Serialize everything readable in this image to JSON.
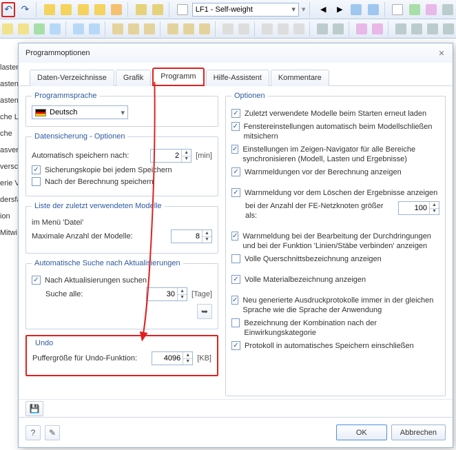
{
  "toolbar": {
    "undo": "↶",
    "redo": "↷",
    "lf_combo": "LF1 - Self-weight"
  },
  "sidebar_scraps": [
    "laster",
    " ",
    "asten",
    "asten",
    " ",
    "che Li",
    "che ",
    "",
    "asverfo",
    "versch",
    "",
    "erie Vo",
    "dersfa",
    "",
    "ion",
    " ",
    "Mitwi"
  ],
  "dialog": {
    "title": "Programmoptionen",
    "tabs": {
      "daten": "Daten-Verzeichnisse",
      "grafik": "Grafik",
      "programm": "Programm",
      "hilfe": "Hilfe-Assistent",
      "kommentare": "Kommentare"
    },
    "left": {
      "lang": {
        "legend": "Programmsprache",
        "value": "Deutsch"
      },
      "backup": {
        "legend": "Datensicherung - Optionen",
        "auto_label": "Automatisch speichern nach:",
        "auto_value": "2",
        "auto_unit": "[min]",
        "copy_label": "Sicherungskopie bei jedem Speichern",
        "after_label": "Nach der Berechnung speichern"
      },
      "recent": {
        "legend": "Liste der zuletzt verwendeten Modelle",
        "sub": "im Menü 'Datei'",
        "max_label": "Maximale Anzahl der Modelle:",
        "max_value": "8"
      },
      "updates": {
        "legend": "Automatische Suche nach Aktualisierungen",
        "search_label": "Nach Aktualisierungen suchen",
        "every_label": "Suche alle:",
        "every_value": "30",
        "every_unit": "[Tage]"
      },
      "undo": {
        "legend": "Undo",
        "buffer_label": "Puffergröße für Undo-Funktion:",
        "buffer_value": "4096",
        "buffer_unit": "[KB]"
      }
    },
    "right": {
      "legend": "Optionen",
      "opt1": "Zuletzt verwendete Modelle beim Starten erneut laden",
      "opt2": "Fenstereinstellungen automatisch beim Modellschließen mitsichern",
      "opt3": "Einstellungen im Zeigen-Navigator für alle Bereiche synchronisieren (Modell, Lasten und Ergebnisse)",
      "opt4": "Warnmeldungen vor der Berechnung anzeigen",
      "opt5": "Warnmeldung vor dem Löschen der Ergebnisse anzeigen",
      "opt5b": "bei der Anzahl der FE-Netzknoten größer als:",
      "opt5b_val": "100",
      "opt6": "Warnmeldung bei der Bearbeitung der Durchdringungen und bei der Funktion 'Linien/Stäbe verbinden' anzeigen",
      "opt7": "Volle Querschnittsbezeichnung anzeigen",
      "opt8": "Volle Materialbezeichnung anzeigen",
      "opt9": "Neu generierte Ausdruckprotokolle immer in der gleichen Sprache wie die Sprache der Anwendung",
      "opt10": "Bezeichnung der Kombination nach der Einwirkungskategorie",
      "opt11": "Protokoll in automatisches Speichern einschließen"
    },
    "buttons": {
      "ok": "OK",
      "cancel": "Abbrechen"
    }
  }
}
